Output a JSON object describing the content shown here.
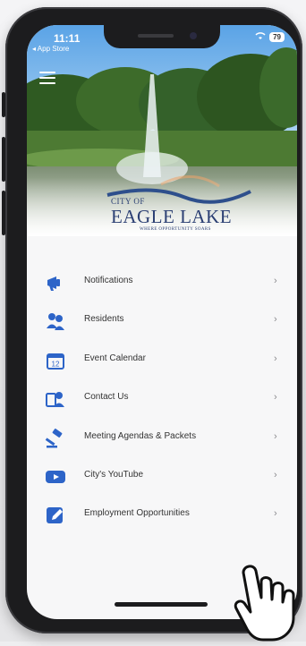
{
  "status_bar": {
    "time": "11:11",
    "back_label": "◂ App Store",
    "battery": "79"
  },
  "city_logo": {
    "city_of": "CITY OF",
    "name": "EAGLE LAKE",
    "tagline": "WHERE OPPORTUNITY SOARS"
  },
  "menu": {
    "items": [
      {
        "label": "Notifications",
        "icon": "megaphone-icon"
      },
      {
        "label": "Residents",
        "icon": "residents-icon"
      },
      {
        "label": "Event Calendar",
        "icon": "calendar-icon"
      },
      {
        "label": "Contact Us",
        "icon": "contact-icon"
      },
      {
        "label": "Meeting Agendas & Packets",
        "icon": "gavel-icon"
      },
      {
        "label": "City's YouTube",
        "icon": "youtube-icon"
      },
      {
        "label": "Employment Opportunities",
        "icon": "edit-icon"
      }
    ],
    "chevron": "›"
  },
  "colors": {
    "icon_blue": "#2d64c8",
    "logo_navy": "#2b3f73"
  }
}
